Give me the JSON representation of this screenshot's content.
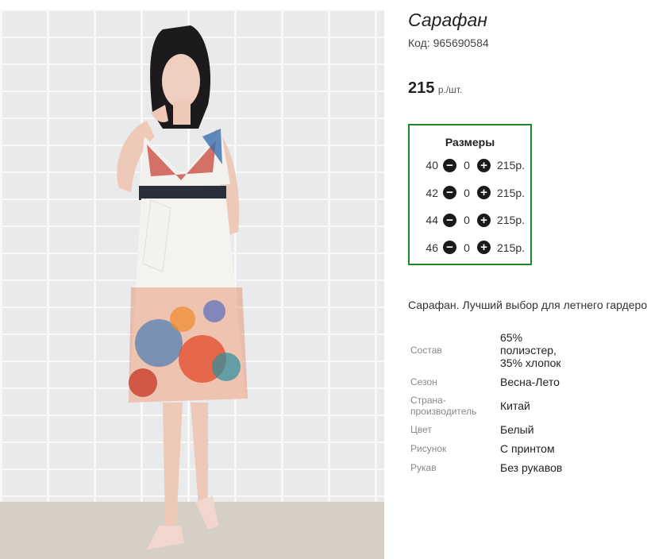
{
  "product": {
    "title": "Сарафан",
    "sku": "Код: 965690584",
    "price": "215",
    "price_unit": "р./шт."
  },
  "sizes": {
    "header": "Размеры",
    "rows": [
      {
        "size": "40",
        "qty": "0",
        "price": "215р."
      },
      {
        "size": "42",
        "qty": "0",
        "price": "215р."
      },
      {
        "size": "44",
        "qty": "0",
        "price": "215р."
      },
      {
        "size": "46",
        "qty": "0",
        "price": "215р."
      }
    ],
    "minus_icon": "minus-circle-icon",
    "plus_icon": "plus-circle-icon"
  },
  "description": "Сарафан. Лучший выбор для летнего гардероба",
  "properties": [
    {
      "label": "Состав",
      "value": "65% полиэстер, 35% хлопок"
    },
    {
      "label": "Сезон",
      "value": "Весна-Лето"
    },
    {
      "label": "Страна-производитель",
      "value": "Китай"
    },
    {
      "label": "Цвет",
      "value": "Белый"
    },
    {
      "label": "Рисунок",
      "value": "С принтом"
    },
    {
      "label": "Рукав",
      "value": "Без рукавов"
    }
  ],
  "colors": {
    "size_box_border": "#1f8a1f",
    "icon": "#1a1a1a"
  }
}
